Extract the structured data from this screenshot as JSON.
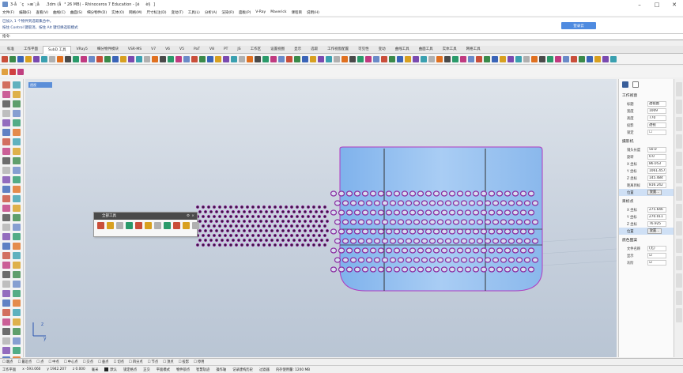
{
  "window": {
    "title": "3-å¨ç»æ¨¡å.3dm (å³ 26 MB) - Rhinoceros 7 Education - [éè§]",
    "minimize": "–",
    "maximize": "□",
    "close": "✕"
  },
  "menu": [
    "文件(F)",
    "编辑(E)",
    "查看(V)",
    "曲线(C)",
    "曲面(S)",
    "细分物件(D)",
    "实体(O)",
    "网格(M)",
    "尺寸标注(D)",
    "变动(T)",
    "工具(L)",
    "分析(A)",
    "渲染(R)",
    "面板(P)",
    "V-Ray",
    "Maverick",
    "课程目",
    "说明(H)"
  ],
  "command_history": {
    "line1": "已加入 1 个物件到选取集合中。",
    "line2": "按住 Control 键取消，按住 Alt 键切换选取模式",
    "button": "登录云"
  },
  "command_prompt": "指令:",
  "tabs": [
    "标准",
    "工作平面",
    "SubD 工具",
    "VRay5",
    "细分物件模块",
    "VSR-MS",
    "V7",
    "V6",
    "V5",
    "PaT",
    "V8",
    "PT",
    "JS",
    "工作区",
    "设置视图",
    "显示",
    "选取",
    "工作视窗配置",
    "可见性",
    "变动",
    "曲线工具",
    "曲面工具",
    "实体工具",
    "网格工具"
  ],
  "active_tab": "SubD 工具",
  "viewport": {
    "label": "透视"
  },
  "float_panel": {
    "title": "全部工具"
  },
  "right_panel": {
    "section1": "工作视窗",
    "props1": [
      {
        "k": "标题",
        "v": "透视图"
      },
      {
        "k": "宽度",
        "v": "1009"
      },
      {
        "k": "高度",
        "v": "770"
      },
      {
        "k": "投影",
        "v": "透视"
      },
      {
        "k": "锁定",
        "v": "☐"
      }
    ],
    "section2": "摄影机",
    "props2": [
      {
        "k": "镜头长度",
        "v": "50.0"
      },
      {
        "k": "旋转",
        "v": "0.0"
      },
      {
        "k": "X 坐标",
        "v": "86.053"
      },
      {
        "k": "Y 坐标",
        "v": "1061.457"
      },
      {
        "k": "Z 坐标",
        "v": "145.484"
      },
      {
        "k": "距离目标",
        "v": "816.242"
      }
    ],
    "place_btn": "放置...",
    "section3": "目标点",
    "props3": [
      {
        "k": "X 坐标",
        "v": "275.646"
      },
      {
        "k": "Y 坐标",
        "v": "270.011"
      },
      {
        "k": "Z 坐标",
        "v": "76.925"
      }
    ],
    "section4": "底色图案",
    "props4": [
      {
        "k": "文件名称",
        "v": "(无)"
      },
      {
        "k": "显示",
        "v": "☑"
      },
      {
        "k": "灰阶",
        "v": "☑"
      }
    ],
    "position_label": "位置"
  },
  "status1": [
    "端点",
    "最近点",
    "点",
    "中点",
    "中心点",
    "交点",
    "垂点",
    "切点",
    "四分点",
    "节点",
    "顶点",
    "投影",
    "停用"
  ],
  "status2": {
    "cplane": "工作平面",
    "x": "x -593.060",
    "y": "y 1942.207",
    "z": "z 0.000",
    "units": "毫米",
    "layer": "默认",
    "items": [
      "锁定格点",
      "正交",
      "平面模式",
      "物件锁点",
      "智慧轨迹",
      "操作轴",
      "记录建构历史",
      "过滤器",
      "内存使用量: 1200 MB"
    ]
  }
}
